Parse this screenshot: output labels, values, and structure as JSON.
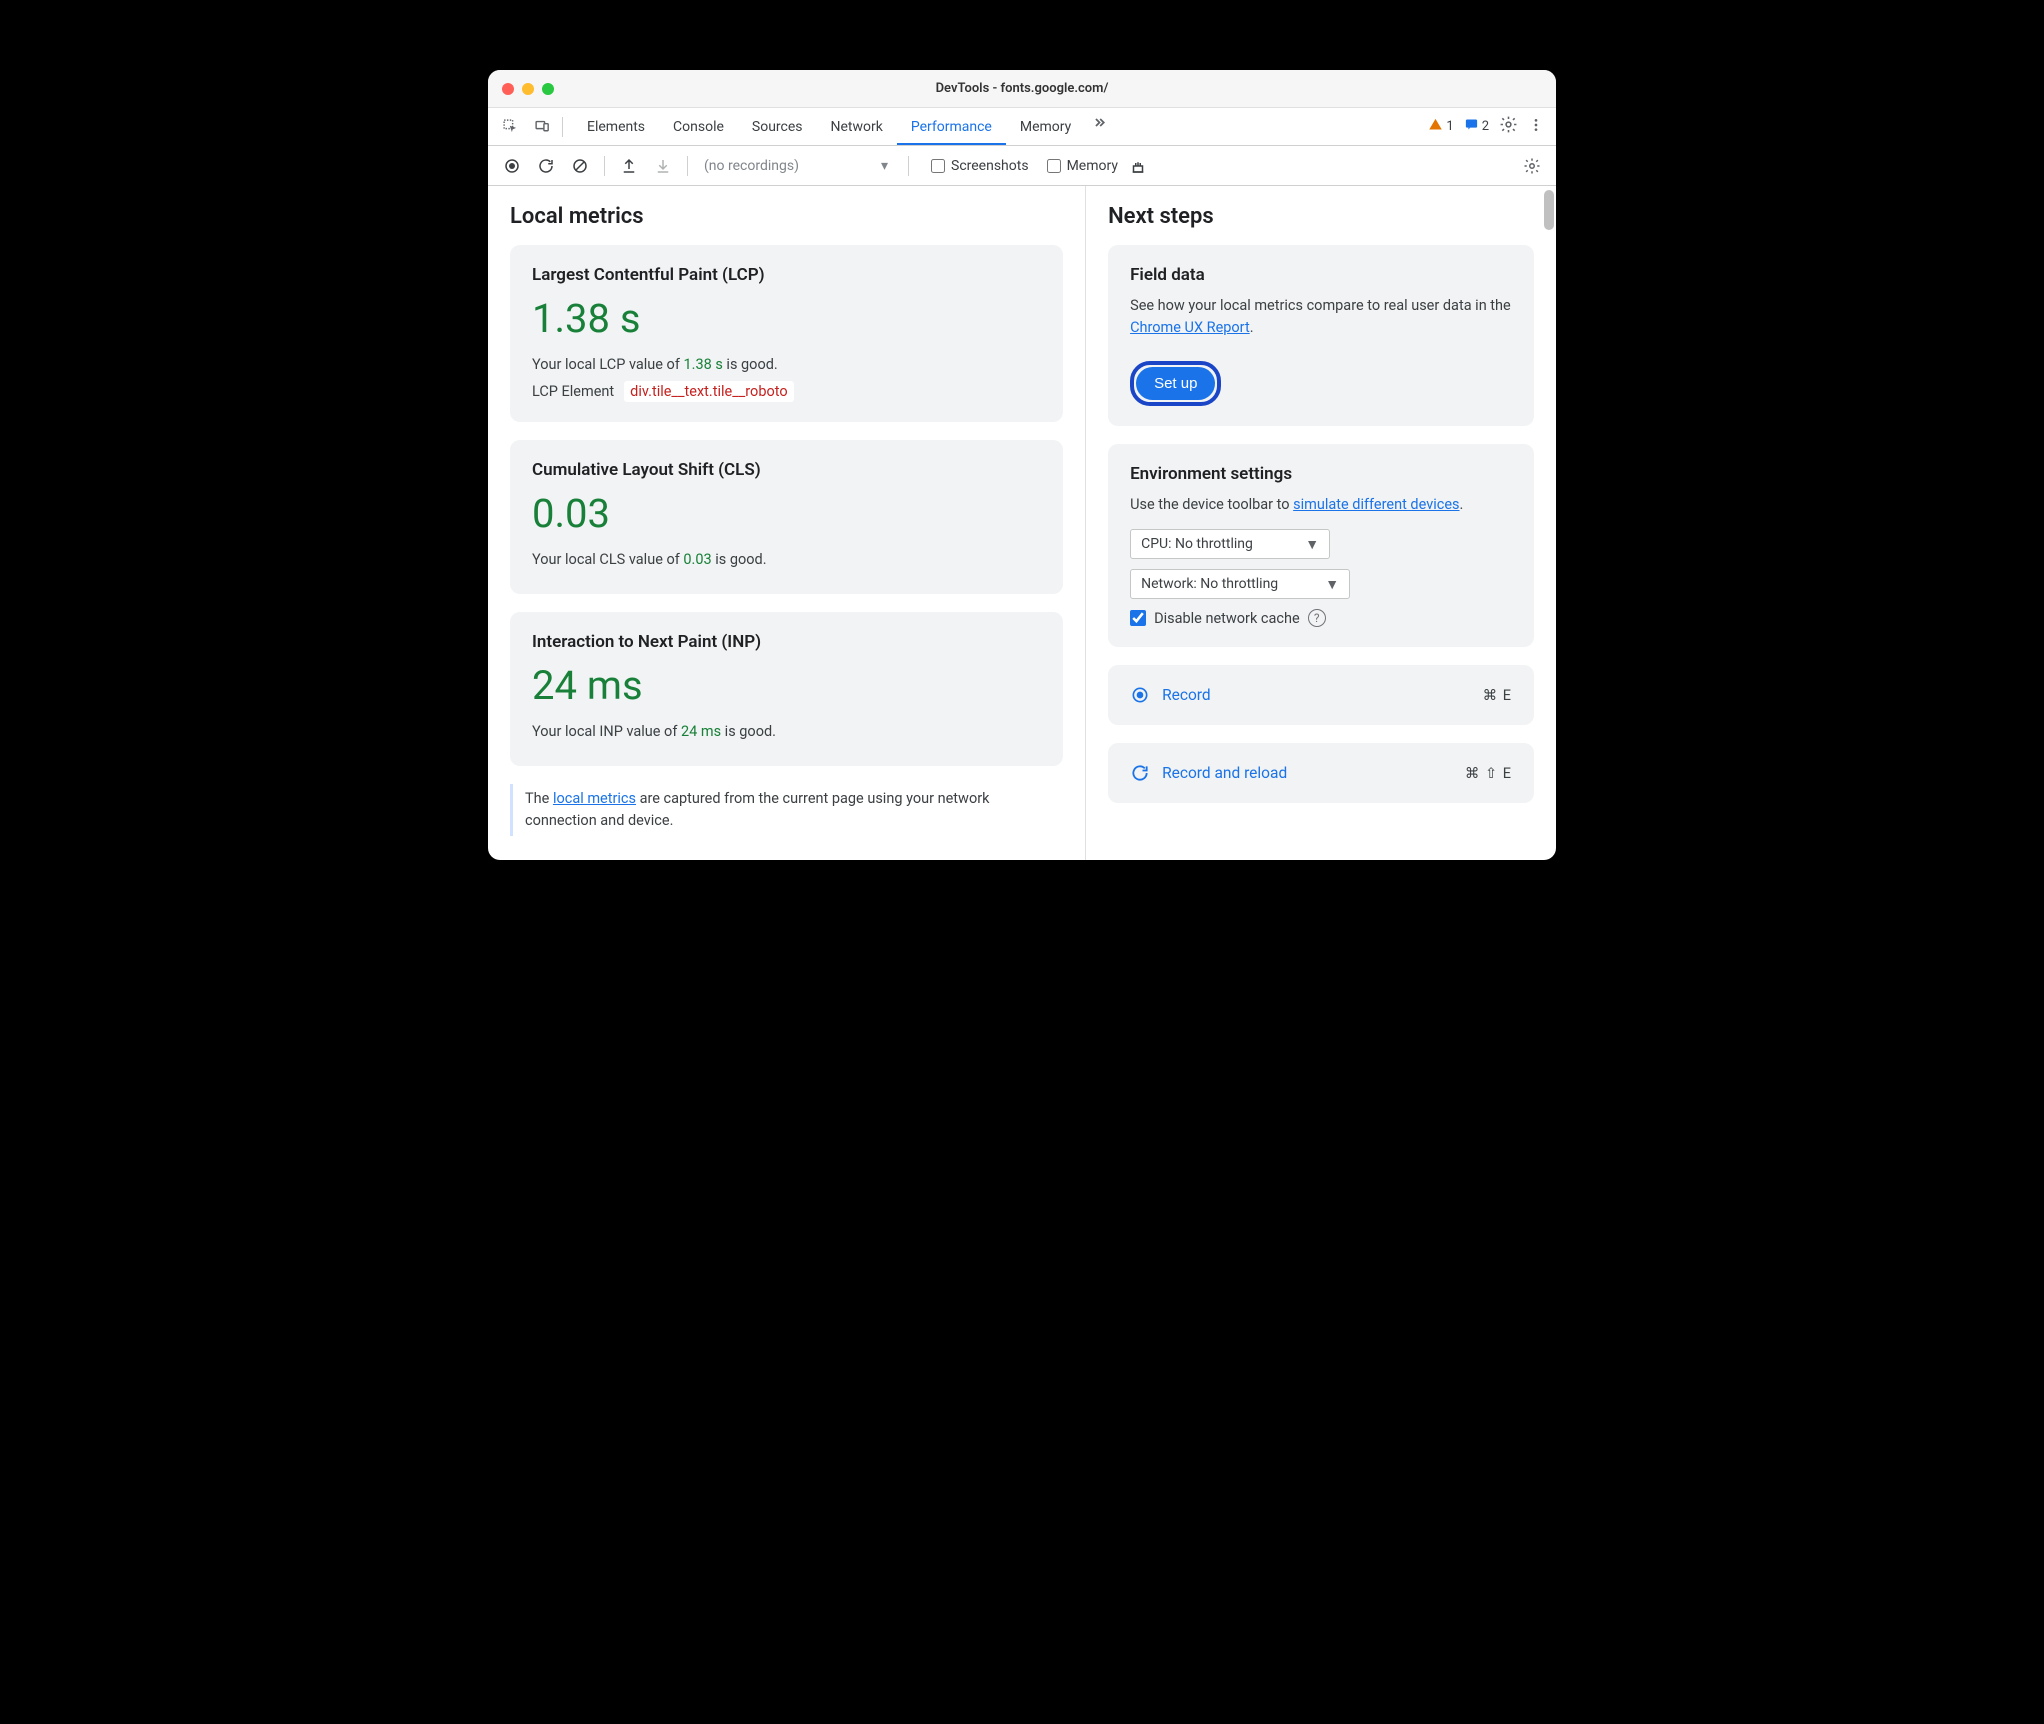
{
  "title": "DevTools - fonts.google.com/",
  "tabs": {
    "elements": "Elements",
    "console": "Console",
    "sources": "Sources",
    "network": "Network",
    "performance": "Performance",
    "memory": "Memory"
  },
  "badges": {
    "warnings": "1",
    "messages": "2"
  },
  "subtoolbar": {
    "no_recordings": "(no recordings)",
    "screenshots": "Screenshots",
    "memory": "Memory"
  },
  "left": {
    "heading": "Local metrics",
    "lcp": {
      "title": "Largest Contentful Paint (LCP)",
      "value": "1.38 s",
      "desc_pre": "Your local LCP value of ",
      "desc_val": "1.38 s",
      "desc_post": " is good.",
      "elem_label": "LCP Element",
      "elem_value": "div.tile__text.tile__roboto"
    },
    "cls": {
      "title": "Cumulative Layout Shift (CLS)",
      "value": "0.03",
      "desc_pre": "Your local CLS value of ",
      "desc_val": "0.03",
      "desc_post": " is good."
    },
    "inp": {
      "title": "Interaction to Next Paint (INP)",
      "value": "24 ms",
      "desc_pre": "Your local INP value of ",
      "desc_val": "24 ms",
      "desc_post": " is good."
    },
    "info_pre": "The ",
    "info_link": "local metrics",
    "info_post": " are captured from the current page using your network connection and device."
  },
  "right": {
    "heading": "Next steps",
    "field": {
      "title": "Field data",
      "desc_pre": "See how your local metrics compare to real user data in the ",
      "desc_link": "Chrome UX Report",
      "desc_post": ".",
      "button": "Set up"
    },
    "env": {
      "title": "Environment settings",
      "desc_pre": "Use the device toolbar to ",
      "desc_link": "simulate different devices",
      "desc_post": ".",
      "cpu": "CPU: No throttling",
      "net": "Network: No throttling",
      "disable_cache": "Disable network cache"
    },
    "record": {
      "label": "Record",
      "shortcut": "⌘ E"
    },
    "reload": {
      "label": "Record and reload",
      "shortcut": "⌘ ⇧ E"
    }
  }
}
